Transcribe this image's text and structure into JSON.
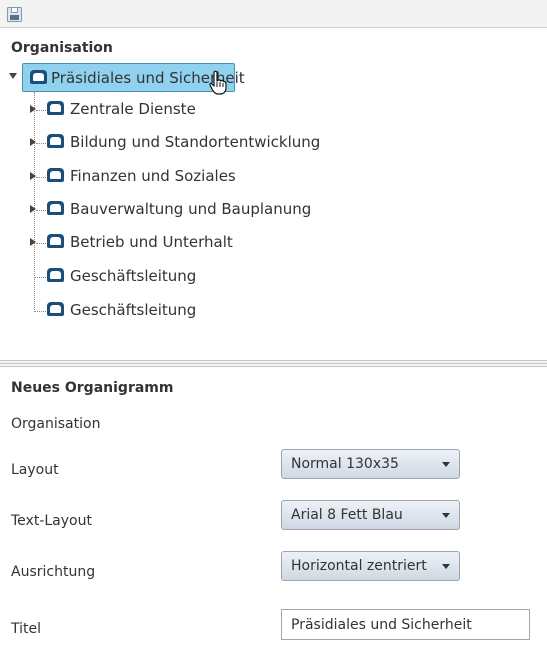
{
  "toolbar": {
    "save_icon": "save-icon"
  },
  "tree": {
    "heading": "Organisation",
    "root": {
      "label": "Präsidiales und Sicherheit",
      "icon": "org-unit-icon",
      "expanded": true,
      "selected": true
    },
    "children": [
      {
        "label": "Zentrale Dienste",
        "has_children": true
      },
      {
        "label": "Bildung und Standortentwicklung",
        "has_children": true
      },
      {
        "label": "Finanzen und Soziales",
        "has_children": true
      },
      {
        "label": "Bauverwaltung und Bauplanung",
        "has_children": true
      },
      {
        "label": "Betrieb und Unterhalt",
        "has_children": true
      },
      {
        "label": "Geschäftsleitung",
        "has_children": false
      },
      {
        "label": "Geschäftsleitung",
        "has_children": false
      }
    ]
  },
  "form": {
    "heading": "Neues Organigramm",
    "organisation_label": "Organisation",
    "layout": {
      "label": "Layout",
      "value": "Normal 130x35"
    },
    "text_layout": {
      "label": "Text-Layout",
      "value": "Arial 8 Fett Blau"
    },
    "ausrichtung": {
      "label": "Ausrichtung",
      "value": "Horizontal zentriert"
    },
    "titel": {
      "label": "Titel",
      "value": "Präsidiales und Sicherheit"
    }
  },
  "colors": {
    "selection_bg": "#8fd1ee",
    "selection_border": "#4a8db3",
    "icon": "#1b4f7a"
  }
}
